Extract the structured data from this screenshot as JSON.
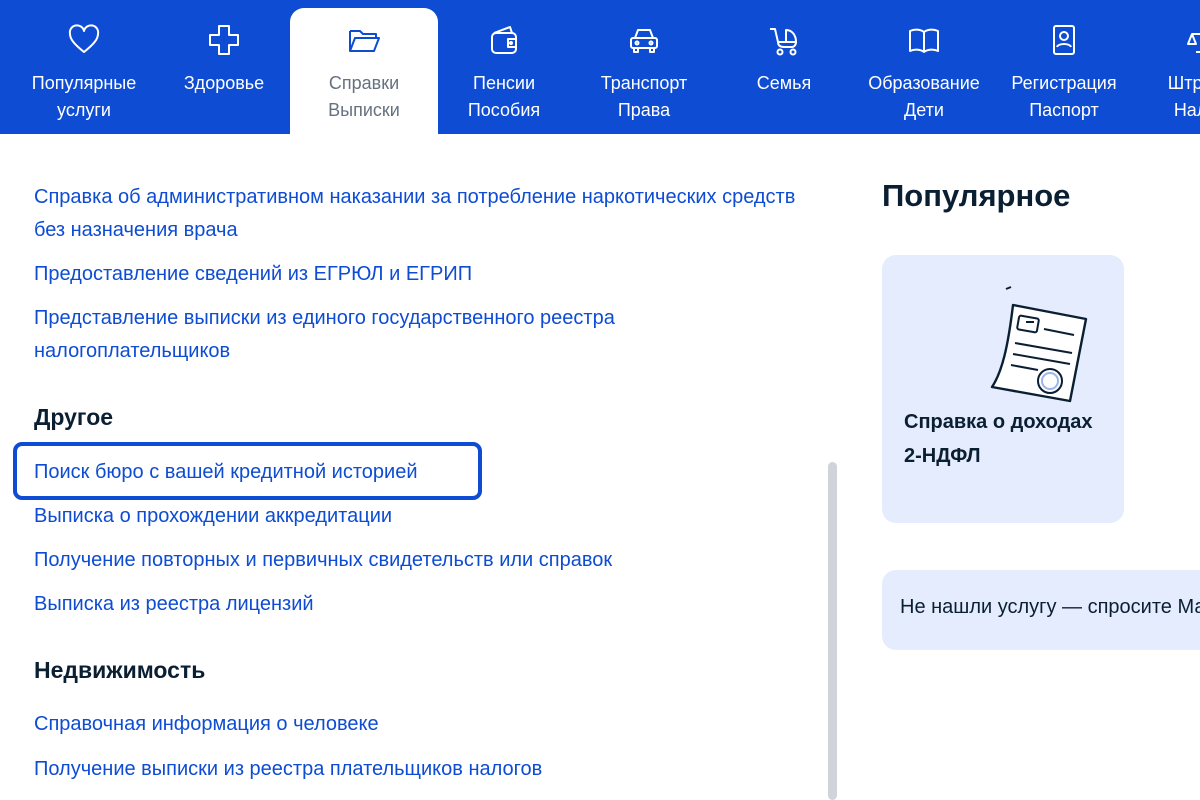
{
  "categories": [
    {
      "line1": "Популярные",
      "line2": "услуги",
      "icon": "heart-icon",
      "active": false
    },
    {
      "line1": "Здоровье",
      "line2": "",
      "icon": "medical-cross-icon",
      "active": false
    },
    {
      "line1": "Справки",
      "line2": "Выписки",
      "icon": "folder-icon",
      "active": true
    },
    {
      "line1": "Пенсии",
      "line2": "Пособия",
      "icon": "wallet-icon",
      "active": false
    },
    {
      "line1": "Транспорт",
      "line2": "Права",
      "icon": "car-icon",
      "active": false
    },
    {
      "line1": "Семья",
      "line2": "",
      "icon": "stroller-icon",
      "active": false
    },
    {
      "line1": "Образование",
      "line2": "Дети",
      "icon": "book-icon",
      "active": false
    },
    {
      "line1": "Регистрация",
      "line2": "Паспорт",
      "icon": "passport-icon",
      "active": false
    },
    {
      "line1": "Штрафы",
      "line2": "Налоги",
      "icon": "scales-icon",
      "active": false
    }
  ],
  "links_top": [
    "Справка об административном наказании за потребление наркотических средств без назначения врача",
    "Предоставление сведений из ЕГРЮЛ и ЕГРИП",
    "Представление выписки из единого государственного реестра налогоплательщиков"
  ],
  "section_other": {
    "title": "Другое",
    "links": [
      "Поиск бюро с вашей кредитной историей",
      "Выписка о прохождении аккредитации",
      "Получение повторных и первичных свидетельств или справок",
      "Выписка из реестра лицензий"
    ]
  },
  "section_realty": {
    "title": "Недвижимость",
    "links": [
      "Справочная информация о человеке",
      "Получение выписки из реестра плательщиков налогов"
    ]
  },
  "popular": {
    "title": "Популярное",
    "card_line1": "Справка о доходах",
    "card_line2": "2-НДФЛ",
    "card_icon": "document-with-seal-icon"
  },
  "ask": {
    "text": "Не нашли услугу — спросите Макса"
  },
  "colors": {
    "brand_blue": "#0d4cd3",
    "card_bg": "#e4ecfd",
    "heading": "#0b1f33"
  }
}
